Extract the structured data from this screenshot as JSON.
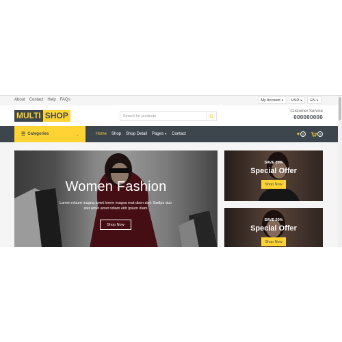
{
  "topbar": {
    "links": [
      "About",
      "Contact",
      "Help",
      "FAQs"
    ],
    "account": "My Account",
    "currency": "USD",
    "language": "EN"
  },
  "header": {
    "logo_part1": "MULTI",
    "logo_part2": "SHOP",
    "search_placeholder": "Search for products",
    "customer_service_label": "Customer Service",
    "customer_service_phone": "000000000"
  },
  "nav": {
    "categories_label": "Categories",
    "links": [
      "Home",
      "Shop",
      "Shop Detail",
      "Pages",
      "Contact"
    ],
    "wishlist_count": "0",
    "cart_count": "0"
  },
  "carousel": {
    "title": "Women Fashion",
    "text": "Lorem rebum magna amet lorem magna erat diam stet. Sadips duo stet amet amet ndiam elitr ipsum diam",
    "button": "Shop Now"
  },
  "offers": [
    {
      "save": "SAVE 20%",
      "title": "Special Offer",
      "button": "Shop Now"
    },
    {
      "save": "SAVE 20%",
      "title": "Special Offer",
      "button": "Shop Now"
    }
  ],
  "colors": {
    "primary": "#ffd333",
    "dark": "#3d464d"
  }
}
